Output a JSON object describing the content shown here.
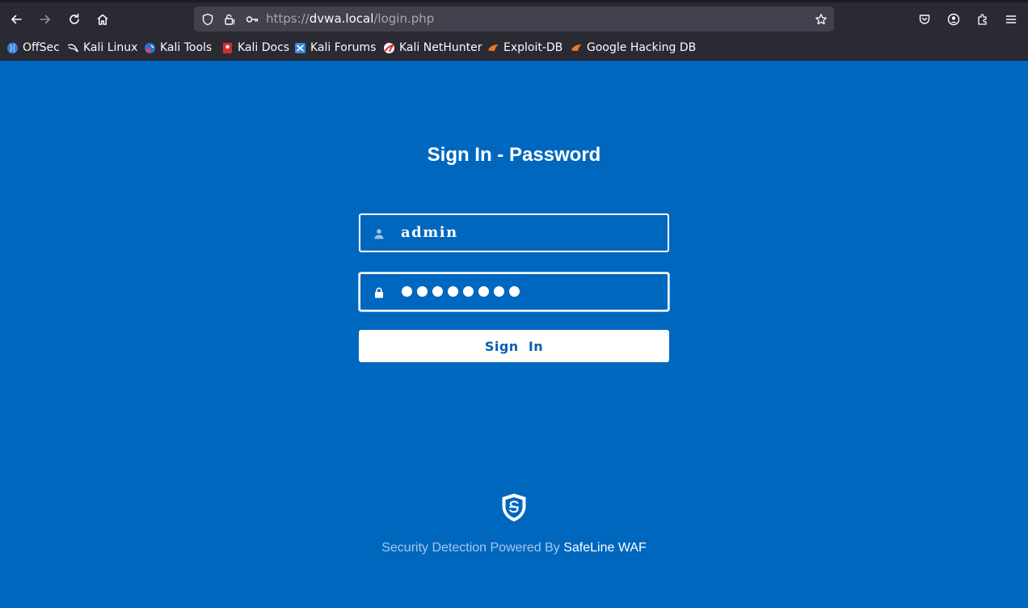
{
  "browser": {
    "url_prefix": "https://",
    "url_host": "dvwa.local",
    "url_path": "/login.php",
    "bookmarks": [
      {
        "label": "OffSec",
        "icon": "offsec-icon"
      },
      {
        "label": "Kali Linux",
        "icon": "kali-dragon-icon"
      },
      {
        "label": "Kali Tools",
        "icon": "kali-tools-icon"
      },
      {
        "label": "Kali Docs",
        "icon": "kali-docs-icon"
      },
      {
        "label": "Kali Forums",
        "icon": "kali-forums-icon"
      },
      {
        "label": "Kali NetHunter",
        "icon": "nethunter-icon"
      },
      {
        "label": "Exploit-DB",
        "icon": "exploit-db-icon"
      },
      {
        "label": "Google Hacking DB",
        "icon": "ghdb-icon"
      }
    ]
  },
  "page": {
    "title": "Sign In - Password",
    "username_value": "admin",
    "password_masked_length": 8,
    "signin_label": "Sign  In",
    "footer_prefix": "Security Detection Powered By ",
    "footer_brand": "SafeLine WAF"
  },
  "colors": {
    "page_bg": "#0067bf",
    "chrome_bg": "#2b2a33",
    "urlbar_bg": "#42414d",
    "button_text": "#0d5fb0"
  }
}
